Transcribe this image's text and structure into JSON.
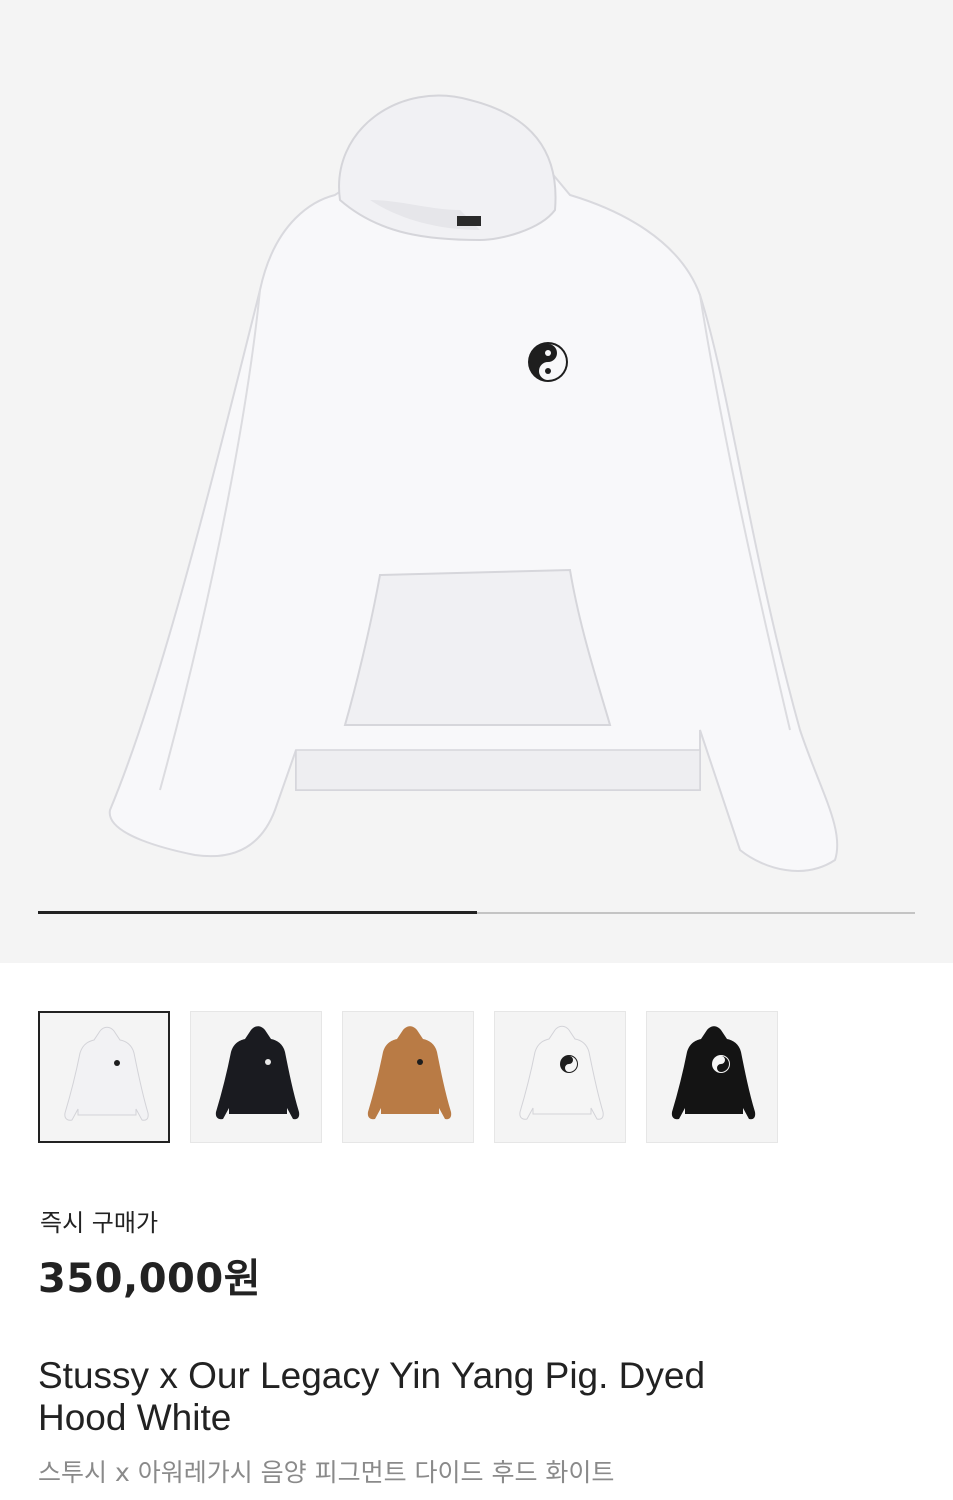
{
  "gallery": {
    "current_slide": 1,
    "total_slides": 2,
    "progress_fraction": 0.5,
    "main_image": {
      "name": "white-hoodie-yin-yang-front",
      "color": "#f7f7f8"
    }
  },
  "thumbnails": [
    {
      "name": "thumb-white-hoodie-small-logo",
      "color": "#f2f2f4",
      "logo": "small-dark",
      "selected": true
    },
    {
      "name": "thumb-black-hoodie-small-logo",
      "color": "#1a1b20",
      "logo": "small-light",
      "selected": false
    },
    {
      "name": "thumb-brown-hoodie-small-logo",
      "color": "#b97b45",
      "logo": "small-dark",
      "selected": false
    },
    {
      "name": "thumb-white-hoodie-large-logo",
      "color": "#f5f5f5",
      "logo": "large-dark",
      "selected": false
    },
    {
      "name": "thumb-black-hoodie-large-logo",
      "color": "#141414",
      "logo": "large-light",
      "selected": false
    }
  ],
  "product": {
    "price_label": "즉시 구매가",
    "price": "350,000원",
    "title": "Stussy x Our Legacy Yin Yang Pig. Dyed Hood White",
    "subtitle": "스투시 x 아워레가시 음양 피그먼트 다이드 후드 화이트"
  }
}
